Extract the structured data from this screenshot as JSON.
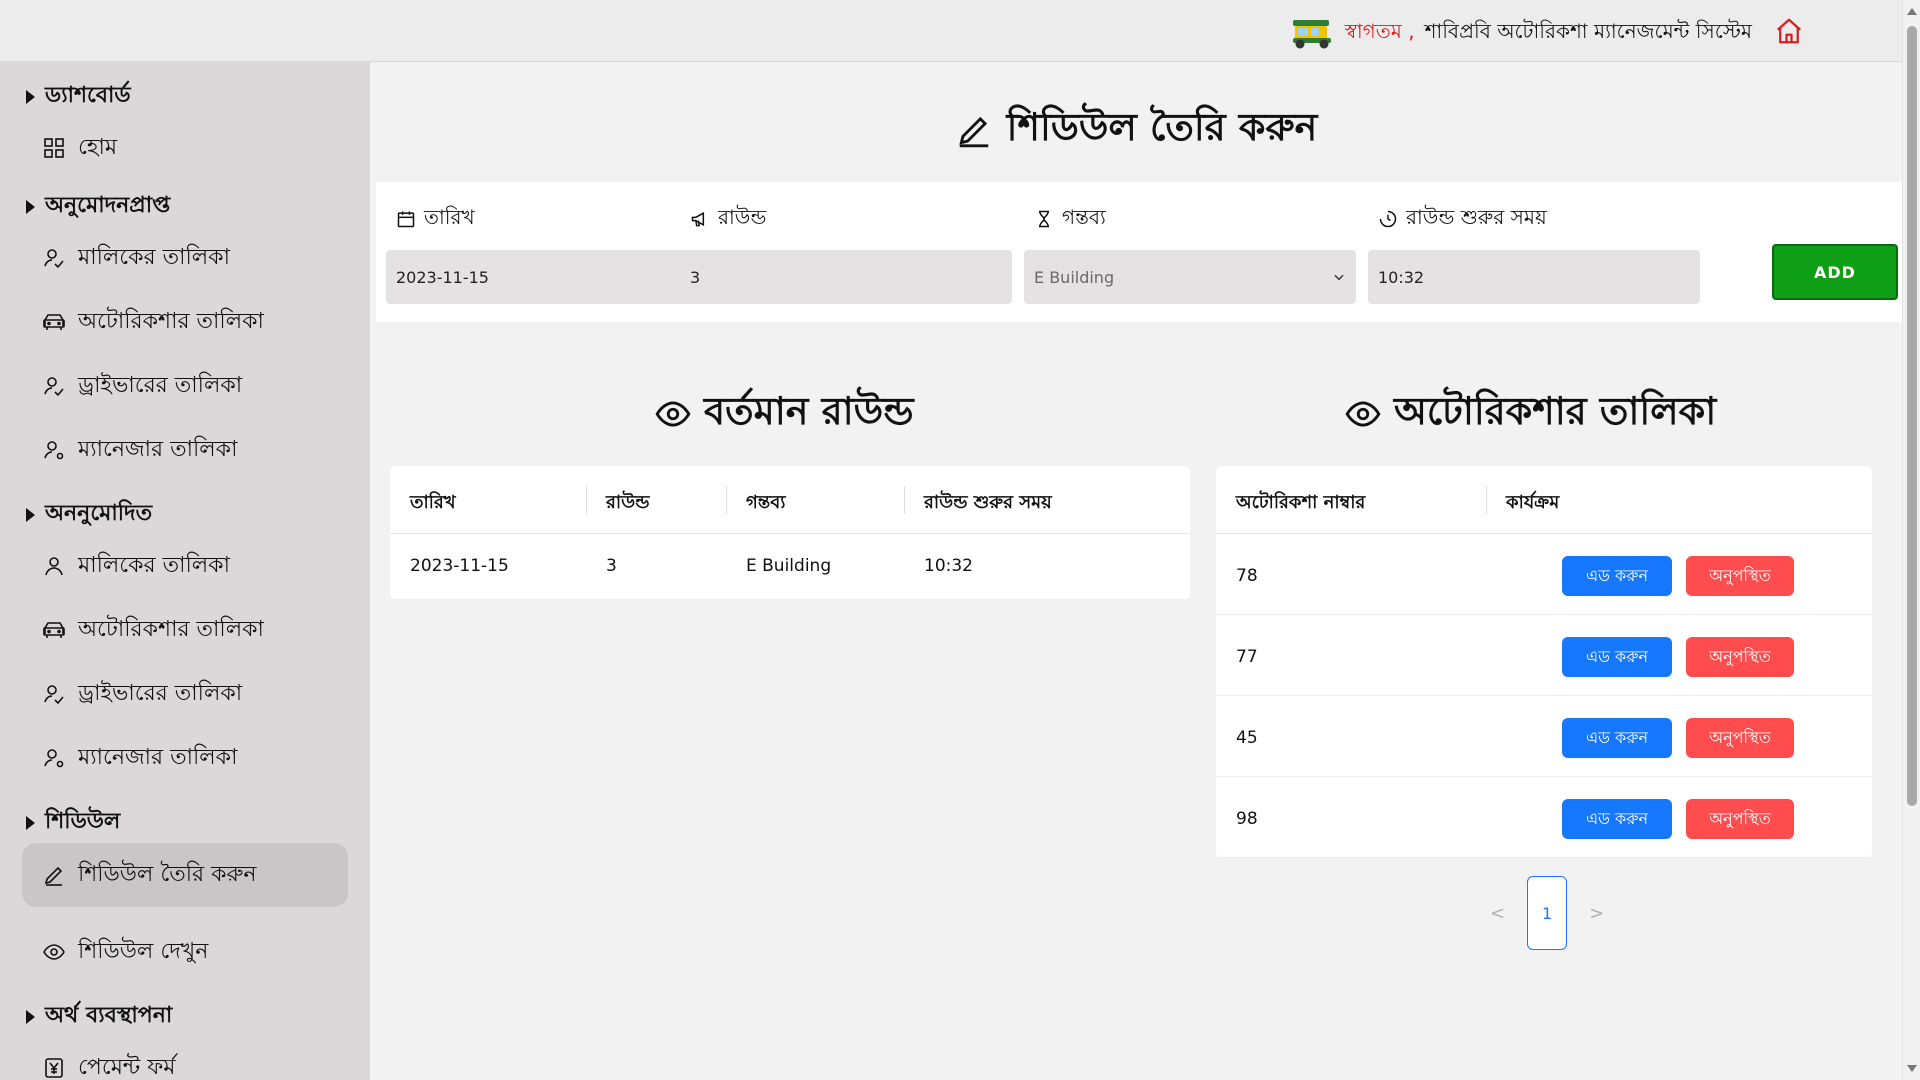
{
  "header": {
    "welcome_prefix": "স্বাগতম ,",
    "welcome_text": "শাবিপ্রবি অটোরিকশা ম্যানেজমেন্ট সিস্টেম",
    "logo_icon": "autorickshaw-icon",
    "home_icon": "home-icon",
    "accent_color": "#d21f1f"
  },
  "sidebar": {
    "sections": [
      {
        "label": "ড্যাশবোর্ড",
        "items": [
          {
            "label": "হোম",
            "icon": "grid-icon"
          }
        ]
      },
      {
        "label": "অনুমোদনপ্রাপ্ত",
        "items": [
          {
            "label": "মালিকের তালিকা",
            "icon": "user-check-icon"
          },
          {
            "label": "অটোরিকশার তালিকা",
            "icon": "car-icon"
          },
          {
            "label": "ড্রাইভারের তালিকা",
            "icon": "user-check-icon"
          },
          {
            "label": "ম্যানেজার তালিকা",
            "icon": "user-settings-icon"
          }
        ]
      },
      {
        "label": "অননুমোদিত",
        "items": [
          {
            "label": "মালিকের তালিকা",
            "icon": "user-icon"
          },
          {
            "label": "অটোরিকশার তালিকা",
            "icon": "car-icon"
          },
          {
            "label": "ড্রাইভারের তালিকা",
            "icon": "user-check-icon"
          },
          {
            "label": "ম্যানেজার তালিকা",
            "icon": "user-settings-icon"
          }
        ]
      },
      {
        "label": "শিডিউল",
        "items": [
          {
            "label": "শিডিউল তৈরি করুন",
            "icon": "pencil-icon",
            "active": true
          },
          {
            "label": "শিডিউল দেখুন",
            "icon": "eye-icon"
          }
        ]
      },
      {
        "label": "অর্থ ব্যবস্থাপনা",
        "items": [
          {
            "label": "পেমেন্ট ফর্ম",
            "icon": "yen-icon"
          }
        ]
      }
    ]
  },
  "main": {
    "title": "শিডিউল তৈরি করুন",
    "form": {
      "date_label": "তারিখ",
      "date_value": "2023-11-15",
      "round_label": "রাউন্ড",
      "round_value": "3",
      "destination_label": "গন্তব্য",
      "destination_value": "E Building",
      "time_label": "রাউন্ড শুরুর সময়",
      "time_value": "10:32",
      "add_label": "ADD",
      "add_color": "#0e9f17"
    },
    "current_round": {
      "title": "বর্তমান রাউন্ড",
      "columns": [
        "তারিখ",
        "রাউন্ড",
        "গন্তব্য",
        "রাউন্ড শুরুর সময়"
      ],
      "rows": [
        [
          "2023-11-15",
          "3",
          "E Building",
          "10:32"
        ]
      ]
    },
    "rickshaw_list": {
      "title": "অটোরিকশার তালিকা",
      "columns": [
        "অটোরিকশা নাম্বার",
        "কার্যক্রম"
      ],
      "add_label": "এড করুন",
      "absent_label": "অনুপস্থিত",
      "rows": [
        "78",
        "77",
        "45",
        "98"
      ],
      "add_color": "#1677ff",
      "absent_color": "#ff4d4f"
    },
    "pagination": {
      "prev": "<",
      "current": "1",
      "next": ">"
    }
  }
}
